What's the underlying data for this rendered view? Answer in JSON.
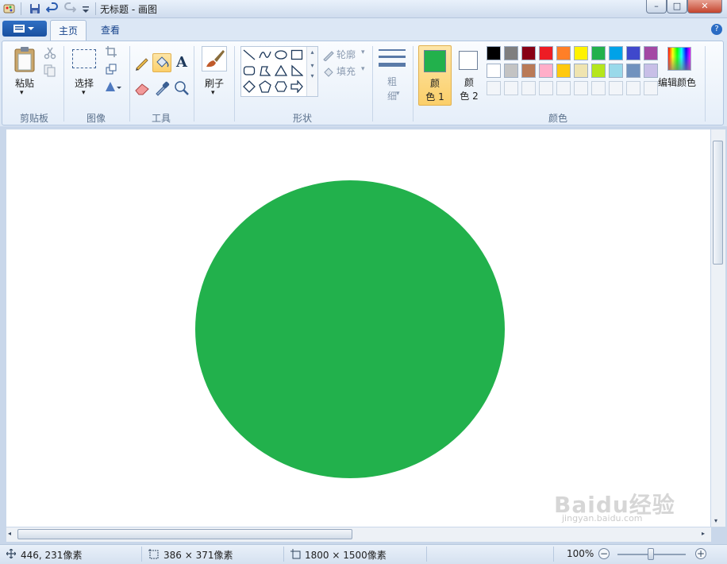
{
  "window": {
    "title": "无标题 - 画图",
    "minimize": "–",
    "maximize": "□",
    "close": "✕"
  },
  "tabs": [
    {
      "label": "主页",
      "selected": true
    },
    {
      "label": "查看",
      "selected": false
    }
  ],
  "help_label": "?",
  "ribbon": {
    "clipboard": {
      "paste_label": "粘贴",
      "group_label": "剪贴板"
    },
    "image": {
      "select_label": "选择",
      "group_label": "图像"
    },
    "tools": {
      "group_label": "工具"
    },
    "brushes": {
      "label": "刷子"
    },
    "shapes": {
      "outline_label": "轮廓",
      "fill_label": "填充",
      "group_label": "形状"
    },
    "size": {
      "label_top": "粗",
      "label_bottom": "细"
    },
    "colors": {
      "color1_label_top": "颜",
      "color1_label_bottom": "色 1",
      "color2_label_top": "颜",
      "color2_label_bottom": "色 2",
      "edit_label": "编辑颜色",
      "group_label": "颜色",
      "color1_value": "#22b14c",
      "color2_value": "#ffffff",
      "palette_row1": [
        "#000000",
        "#7f7f7f",
        "#880015",
        "#ed1c24",
        "#ff7f27",
        "#fff200",
        "#22b14c",
        "#00a2e8",
        "#3f48cc",
        "#a349a4"
      ],
      "palette_row2": [
        "#ffffff",
        "#c3c3c3",
        "#b97a57",
        "#ffaec9",
        "#ffc90e",
        "#efe4b0",
        "#b5e61d",
        "#99d9ea",
        "#7092be",
        "#c8bfe7"
      ]
    }
  },
  "canvas": {
    "background": "#ffffff",
    "circle_color": "#22b14c"
  },
  "status": {
    "cursor_pos": "446, 231像素",
    "selection_size": "386 × 371像素",
    "image_size": "1800 × 1500像素",
    "zoom": "100%"
  },
  "watermark": {
    "text": "Baidu经验",
    "sub": "jingyan.baidu.com"
  }
}
